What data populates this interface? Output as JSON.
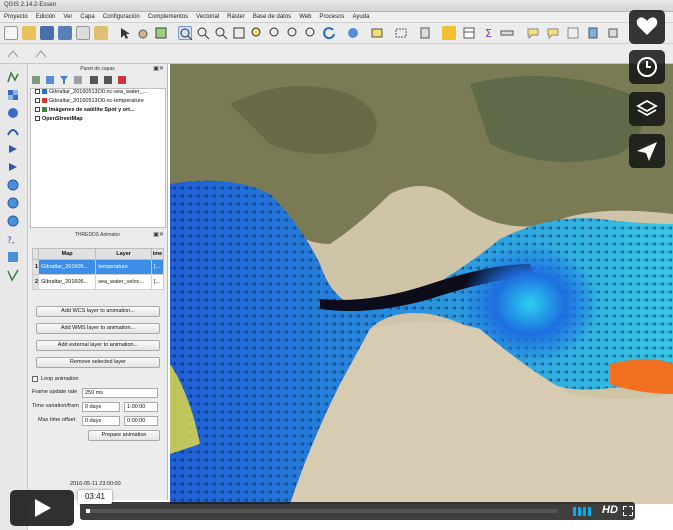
{
  "window": {
    "title": "QGIS 2.14.2-Essen"
  },
  "menu": [
    "Proyecto",
    "Edición",
    "Ver",
    "Capa",
    "Configuración",
    "Complementos",
    "Vectorial",
    "Ráster",
    "Base de datos",
    "Web",
    "Procesos",
    "Ayuda"
  ],
  "layers_panel": {
    "title": "Panel de capas",
    "layers": [
      {
        "name": "Gibraltar_20160513O0.nc-sea_water_...",
        "checked": true,
        "color": "#1f6fd6"
      },
      {
        "name": "Gibraltar_20160513O0.nc-temperature",
        "checked": true,
        "color": "#d03a2a"
      },
      {
        "name": "Imágenes de satélite Spot y ort...",
        "checked": true,
        "color": "#3a8a3a"
      },
      {
        "name": "OpenStreetMap",
        "checked": true,
        "color": "#7aa0c8"
      }
    ]
  },
  "animator": {
    "title": "THREDDS Animator",
    "columns": [
      "Map",
      "Layer",
      "ime"
    ],
    "rows": [
      {
        "index": "1",
        "map": "Gibraltar_201605...",
        "layer": "temperature",
        "time": "[..."
      },
      {
        "index": "2",
        "map": "Gibraltar_201605...",
        "layer": "sea_water_veloc...",
        "time": "[..."
      }
    ],
    "buttons": {
      "add_wcs": "Add WCS layer to animation...",
      "add_wms": "Add WMS layer to animation...",
      "add_external": "Add external layer to animation...",
      "remove": "Remove selected layer",
      "prepare": "Prepare animation"
    },
    "loop_label": "Loop animation",
    "frame_rate_label": "Frame update rate",
    "frame_rate_value": "250 ms",
    "time_variation_label": "Time variation/fram",
    "time_variation_days": "0 days",
    "time_variation_time": "1:00:00",
    "max_offset_label": "Max time offset",
    "max_offset_days": "0 days",
    "max_offset_time": "0:00:00",
    "timestamp": "2016-05-11 23:00:00"
  },
  "video": {
    "current_time": "03:41",
    "hd_label": "HD"
  },
  "colors": {
    "play": "#ffffff",
    "overlay": "#141414",
    "water_deep": "#1e6fe0",
    "selection": "#3d8ee8"
  }
}
